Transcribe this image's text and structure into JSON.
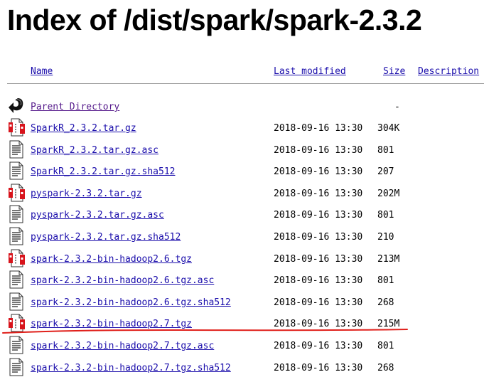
{
  "title": "Index of /dist/spark/spark-2.3.2",
  "columns": {
    "name": "Name",
    "last_modified": "Last modified",
    "size": "Size",
    "description": "Description"
  },
  "parent": {
    "label": "Parent Directory",
    "size": "-"
  },
  "rows": [
    {
      "name": "SparkR_2.3.2.tar.gz",
      "modified": "2018-09-16 13:30",
      "size": "304K",
      "icon": "archive-icon"
    },
    {
      "name": "SparkR_2.3.2.tar.gz.asc",
      "modified": "2018-09-16 13:30",
      "size": "801",
      "icon": "text-file-icon"
    },
    {
      "name": "SparkR_2.3.2.tar.gz.sha512",
      "modified": "2018-09-16 13:30",
      "size": "207",
      "icon": "text-file-icon"
    },
    {
      "name": "pyspark-2.3.2.tar.gz",
      "modified": "2018-09-16 13:30",
      "size": "202M",
      "icon": "archive-icon"
    },
    {
      "name": "pyspark-2.3.2.tar.gz.asc",
      "modified": "2018-09-16 13:30",
      "size": "801",
      "icon": "text-file-icon"
    },
    {
      "name": "pyspark-2.3.2.tar.gz.sha512",
      "modified": "2018-09-16 13:30",
      "size": "210",
      "icon": "text-file-icon"
    },
    {
      "name": "spark-2.3.2-bin-hadoop2.6.tgz",
      "modified": "2018-09-16 13:30",
      "size": "213M",
      "icon": "archive-icon"
    },
    {
      "name": "spark-2.3.2-bin-hadoop2.6.tgz.asc",
      "modified": "2018-09-16 13:30",
      "size": "801",
      "icon": "text-file-icon"
    },
    {
      "name": "spark-2.3.2-bin-hadoop2.6.tgz.sha512",
      "modified": "2018-09-16 13:30",
      "size": "268",
      "icon": "text-file-icon"
    },
    {
      "name": "spark-2.3.2-bin-hadoop2.7.tgz",
      "modified": "2018-09-16 13:30",
      "size": "215M",
      "icon": "archive-icon"
    },
    {
      "name": "spark-2.3.2-bin-hadoop2.7.tgz.asc",
      "modified": "2018-09-16 13:30",
      "size": "801",
      "icon": "text-file-icon"
    },
    {
      "name": "spark-2.3.2-bin-hadoop2.7.tgz.sha512",
      "modified": "2018-09-16 13:30",
      "size": "268",
      "icon": "text-file-icon"
    }
  ],
  "colors": {
    "link": "#1a0dab",
    "visited_link": "#551a8b",
    "annotation": "#e0201b"
  }
}
